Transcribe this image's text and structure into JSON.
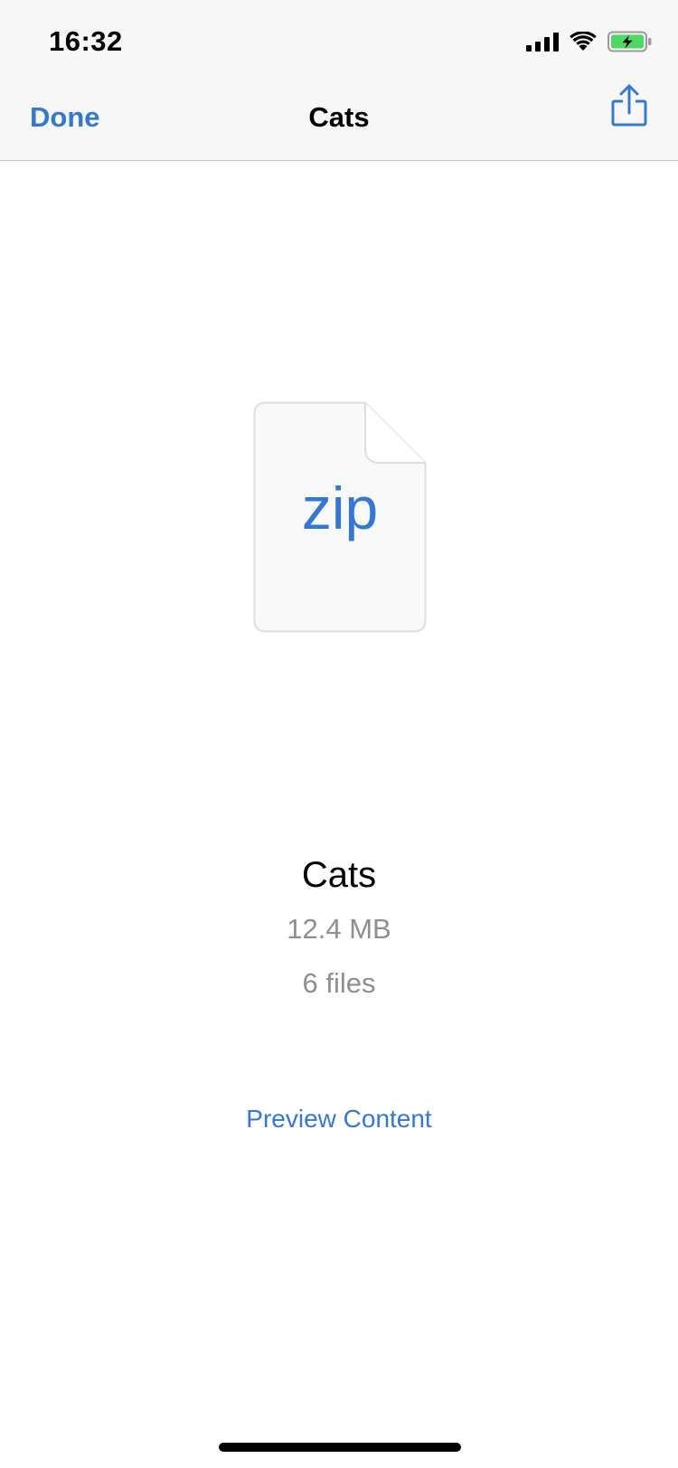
{
  "status_bar": {
    "time": "16:32",
    "icons": [
      "cellular-signal-icon",
      "wifi-icon",
      "battery-charging-icon"
    ],
    "battery_color": "#4cd964"
  },
  "nav_bar": {
    "done_label": "Done",
    "title": "Cats",
    "share_icon": "share-icon"
  },
  "file": {
    "icon": "zip-file-icon",
    "extension": "zip",
    "name": "Cats",
    "size": "12.4 MB",
    "count": "6 files"
  },
  "actions": {
    "preview_label": "Preview Content"
  },
  "colors": {
    "accent": "#3478d6",
    "secondary_text": "#8e8e93",
    "nav_background": "#f7f7f7"
  }
}
